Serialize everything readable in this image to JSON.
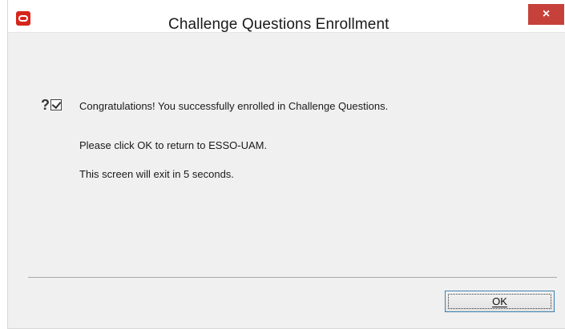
{
  "window": {
    "title": "Challenge Questions Enrollment",
    "close_label": "×"
  },
  "message": {
    "icon_glyph": "?",
    "line1": "Congratulations! You successfully enrolled in Challenge Questions.",
    "line2": "Please click OK to return to ESSO-UAM.",
    "line3": "This screen will exit in 5 seconds."
  },
  "buttons": {
    "ok_label": "OK"
  },
  "colors": {
    "close_button": "#c7413b",
    "app_icon": "#d6261b",
    "ok_border": "#3c7fb1"
  }
}
